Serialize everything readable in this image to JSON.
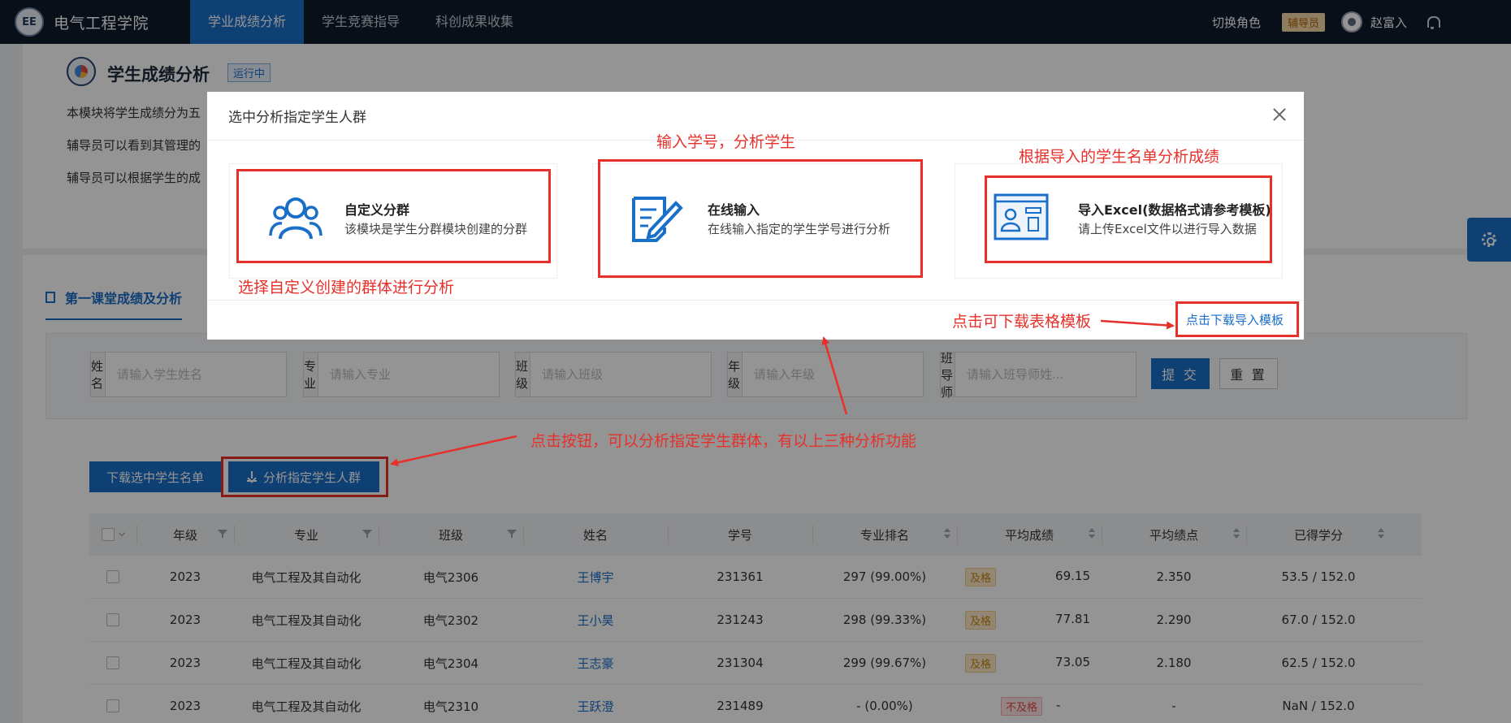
{
  "nav": {
    "school": "电气工程学院",
    "logo_text": "EE",
    "tabs": [
      "学业成绩分析",
      "学生竞赛指导",
      "科创成果收集"
    ],
    "switch_role": "切换角色",
    "role": "辅导员",
    "user": "赵富入"
  },
  "module": {
    "title": "学生成绩分析",
    "status": "运行中",
    "descs": [
      "本模块将学生成绩分为五",
      "辅导员可以看到其管理的",
      "辅导员可以根据学生的成"
    ]
  },
  "section_tab": "第一课堂成绩及分析",
  "filters": [
    {
      "label": "姓名",
      "placeholder": "请输入学生姓名"
    },
    {
      "label": "专业",
      "placeholder": "请输入专业"
    },
    {
      "label": "班级",
      "placeholder": "请输入班级"
    },
    {
      "label": "年级",
      "placeholder": "请输入年级"
    },
    {
      "label": "班导师",
      "placeholder": "请输入班导师姓..."
    }
  ],
  "buttons": {
    "submit": "提 交",
    "reset": "重 置",
    "download": "下载选中学生名单",
    "analyze": "分析指定学生人群"
  },
  "table": {
    "headers": [
      "年级",
      "专业",
      "班级",
      "姓名",
      "学号",
      "专业排名",
      "平均成绩",
      "平均绩点",
      "已得学分"
    ],
    "rows": [
      {
        "grade": "2023",
        "major": "电气工程及其自动化",
        "class": "电气2306",
        "name": "王博宇",
        "id": "231361",
        "rank": "297 (99.00%)",
        "level": "及格",
        "score": "69.15",
        "gpa": "2.350",
        "credits": "53.5 / 152.0"
      },
      {
        "grade": "2023",
        "major": "电气工程及其自动化",
        "class": "电气2302",
        "name": "王小昊",
        "id": "231243",
        "rank": "298 (99.33%)",
        "level": "及格",
        "score": "77.81",
        "gpa": "2.290",
        "credits": "67.0 / 152.0"
      },
      {
        "grade": "2023",
        "major": "电气工程及其自动化",
        "class": "电气2304",
        "name": "王志豪",
        "id": "231304",
        "rank": "299 (99.67%)",
        "level": "及格",
        "score": "73.05",
        "gpa": "2.180",
        "credits": "62.5 / 152.0"
      },
      {
        "grade": "2023",
        "major": "电气工程及其自动化",
        "class": "电气2310",
        "name": "王跃澄",
        "id": "231489",
        "rank": "- (0.00%)",
        "level": "不及格",
        "score": "-",
        "gpa": "-",
        "credits": "NaN / 152.0"
      }
    ]
  },
  "modal": {
    "title": "选中分析指定学生人群",
    "options": [
      {
        "name": "自定义分群",
        "desc": "该模块是学生分群模块创建的分群",
        "icon": "users-group-icon"
      },
      {
        "name": "在线输入",
        "desc": "在线输入指定的学生学号进行分析",
        "icon": "edit-document-icon"
      },
      {
        "name": "导入Excel(数据格式请参考模板)",
        "desc": "请上传Excel文件以进行导入数据",
        "icon": "import-profile-icon"
      }
    ],
    "download_template": "点击下载导入模板"
  },
  "annotations": {
    "online": "输入学号，分析学生",
    "excel": "根据导入的学生名单分析成绩",
    "custom": "选择自定义创建的群体进行分析",
    "template": "点击可下载表格模板",
    "button": "点击按钮，可以分析指定学生群体，有以上三种分析功能"
  },
  "colors": {
    "primary": "#1a6fc9",
    "nav_bg": "#0e1b2b",
    "annotation": "#e8302a"
  }
}
